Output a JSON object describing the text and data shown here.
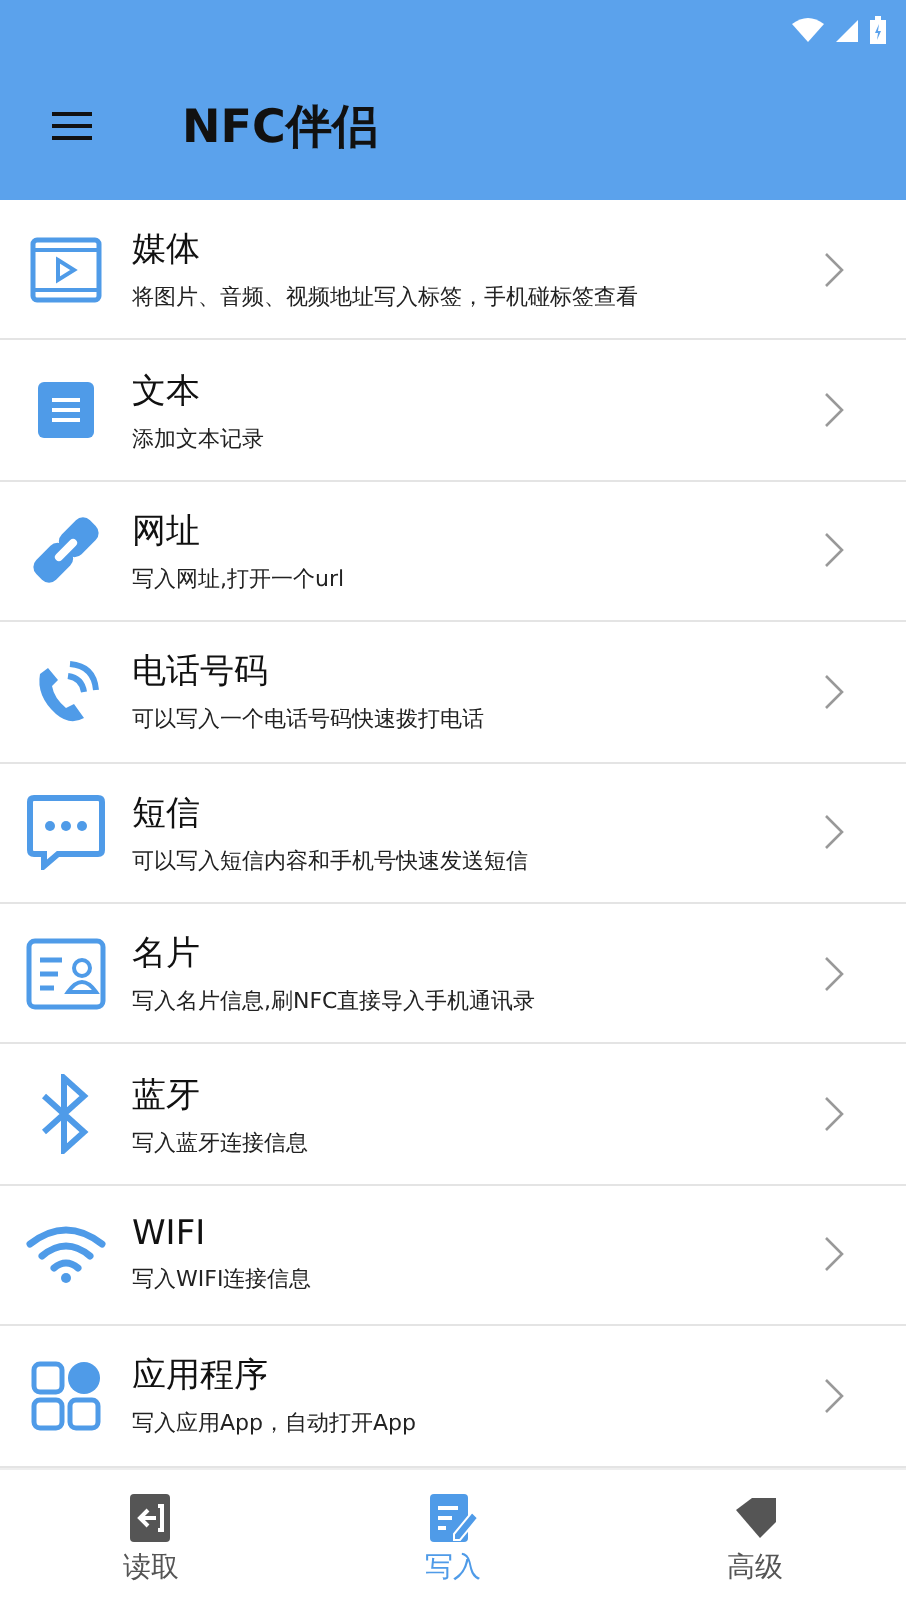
{
  "app_bar": {
    "title": "NFC伴侣"
  },
  "items": [
    {
      "kind": "media",
      "title": "媒体",
      "subtitle": "将图片、音频、视频地址写入标签，手机碰标签查看"
    },
    {
      "kind": "text",
      "title": "文本",
      "subtitle": "添加文本记录"
    },
    {
      "kind": "link",
      "title": "网址",
      "subtitle": "写入网址,打开一个url"
    },
    {
      "kind": "phone",
      "title": "电话号码",
      "subtitle": "可以写入一个电话号码快速拨打电话"
    },
    {
      "kind": "sms",
      "title": "短信",
      "subtitle": "可以写入短信内容和手机号快速发送短信"
    },
    {
      "kind": "card",
      "title": "名片",
      "subtitle": "写入名片信息,刷NFC直接导入手机通讯录"
    },
    {
      "kind": "bluetooth",
      "title": "蓝牙",
      "subtitle": "写入蓝牙连接信息"
    },
    {
      "kind": "wifi",
      "title": "WIFI",
      "subtitle": "写入WIFI连接信息"
    },
    {
      "kind": "apps",
      "title": "应用程序",
      "subtitle": "写入应用App，自动打开App"
    }
  ],
  "bottom_nav": [
    {
      "kind": "read",
      "label": "读取",
      "selected": false
    },
    {
      "kind": "write",
      "label": "写入",
      "selected": true
    },
    {
      "kind": "advanced",
      "label": "高级",
      "selected": false
    }
  ]
}
